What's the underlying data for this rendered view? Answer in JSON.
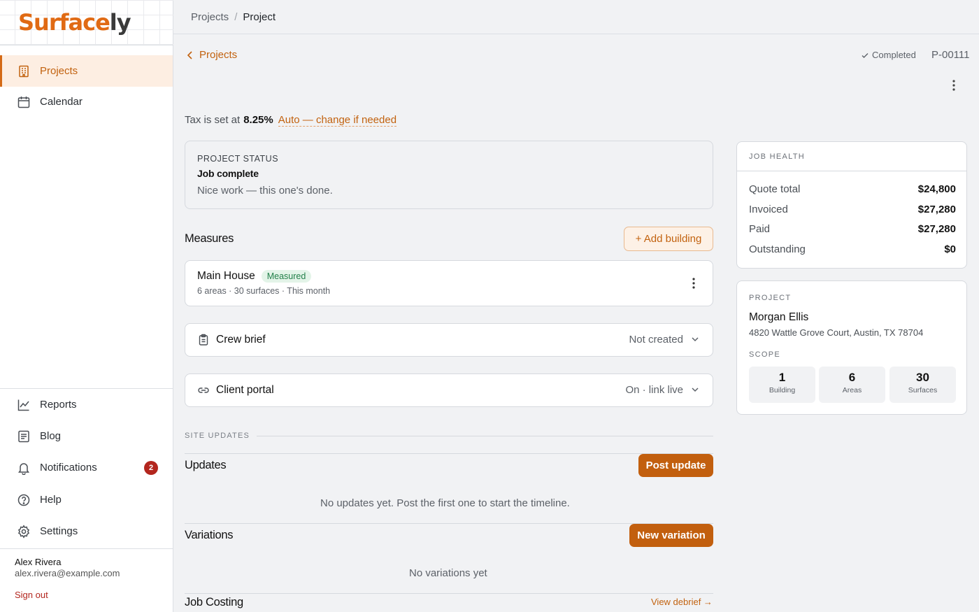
{
  "brand": {
    "part1": "Surface",
    "part2": "ly"
  },
  "sidebar": {
    "primary": [
      {
        "label": "Projects",
        "icon": "building-icon",
        "active": true
      },
      {
        "label": "Calendar",
        "icon": "calendar-icon",
        "active": false
      }
    ],
    "secondary": [
      {
        "label": "Reports",
        "icon": "chart-icon"
      },
      {
        "label": "Blog",
        "icon": "document-icon"
      },
      {
        "label": "Notifications",
        "icon": "bell-icon",
        "badge": "2"
      },
      {
        "label": "Help",
        "icon": "help-icon"
      },
      {
        "label": "Settings",
        "icon": "gear-icon"
      }
    ],
    "user": {
      "name": "Alex Rivera",
      "email": "alex.rivera@example.com",
      "sign_out": "Sign out"
    }
  },
  "breadcrumb": {
    "parent": "Projects",
    "separator": "/",
    "current": "Project"
  },
  "header": {
    "back_label": "Projects",
    "status": "Completed",
    "project_id": "P-00111"
  },
  "tax": {
    "prefix": "Tax is set at",
    "rate": "8.25%",
    "auto_label": "Auto — change if needed"
  },
  "project_status": {
    "label": "PROJECT STATUS",
    "title": "Job complete",
    "description": "Nice work — this one's done."
  },
  "measures": {
    "title": "Measures",
    "add_button": "+ Add building",
    "buildings": [
      {
        "name": "Main House",
        "badge": "Measured",
        "meta": "6 areas · 30 surfaces · This month"
      }
    ]
  },
  "crew_brief": {
    "label": "Crew brief",
    "value": "Not created"
  },
  "client_portal": {
    "label": "Client portal",
    "value": "On · link live"
  },
  "site_updates": {
    "section_label": "SITE UPDATES",
    "updates": {
      "title": "Updates",
      "button": "Post update",
      "empty": "No updates yet. Post the first one to start the timeline."
    },
    "variations": {
      "title": "Variations",
      "button": "New variation",
      "empty": "No variations yet"
    },
    "job_costing": {
      "title": "Job Costing",
      "link": "View debrief →"
    }
  },
  "job_health": {
    "label": "JOB HEALTH",
    "rows": [
      {
        "key": "Quote total",
        "value": "$24,800"
      },
      {
        "key": "Invoiced",
        "value": "$27,280"
      },
      {
        "key": "Paid",
        "value": "$27,280"
      },
      {
        "key": "Outstanding",
        "value": "$0"
      }
    ]
  },
  "project_info": {
    "label": "PROJECT",
    "client": "Morgan Ellis",
    "address": "4820 Wattle Grove Court, Austin, TX 78704",
    "scope_label": "SCOPE",
    "scope": [
      {
        "value": "1",
        "caption": "Building"
      },
      {
        "value": "6",
        "caption": "Areas"
      },
      {
        "value": "30",
        "caption": "Surfaces"
      }
    ]
  },
  "colors": {
    "accent": "#c2620f",
    "active_bg": "#fdeee2",
    "badge": "#b3261e",
    "success": "#23804a"
  }
}
